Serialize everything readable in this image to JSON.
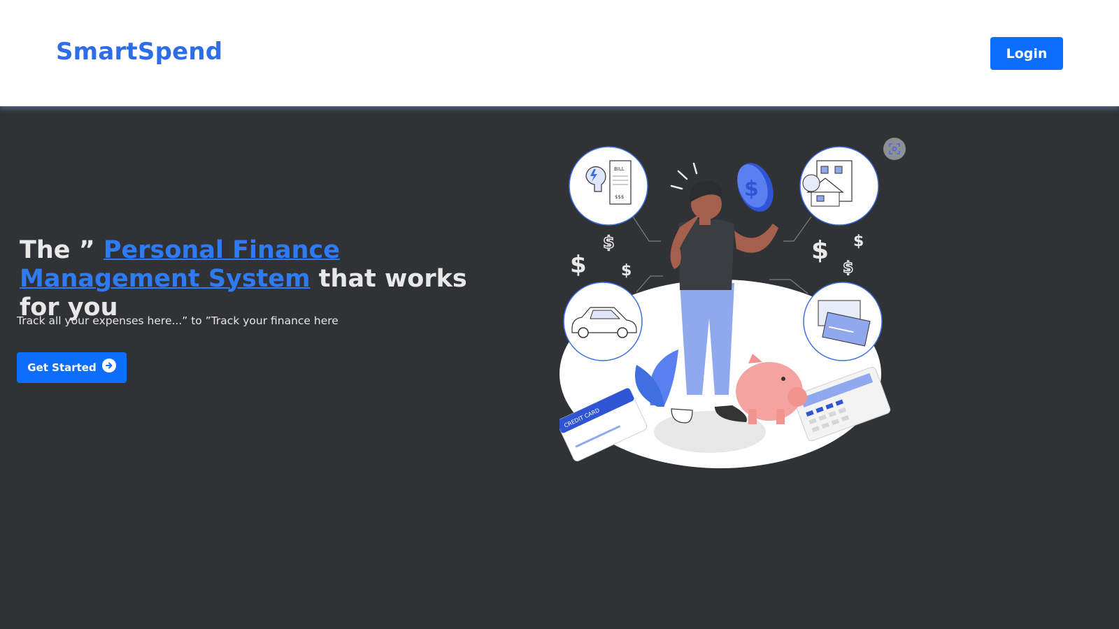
{
  "brand": {
    "name": "SmartSpend",
    "color": "#2f6ce8"
  },
  "nav": {
    "login_label": "Login"
  },
  "hero": {
    "title_prefix": "The ” ",
    "title_link": "Personal Finance Management System",
    "title_suffix": " that works for you",
    "subtitle": "Track all your expenses here...” to ”Track your finance here",
    "cta_label": "Get Started",
    "cta_icon": "arrow-circle-right-icon"
  },
  "illustration": {
    "bill_label": "BILL",
    "bill_amount": "$$$",
    "card_label": "CREDIT CARD",
    "scan_icon": "scan-icon"
  },
  "colors": {
    "accent": "#0d6efd",
    "link": "#2f7bf5",
    "background": "#313235"
  }
}
